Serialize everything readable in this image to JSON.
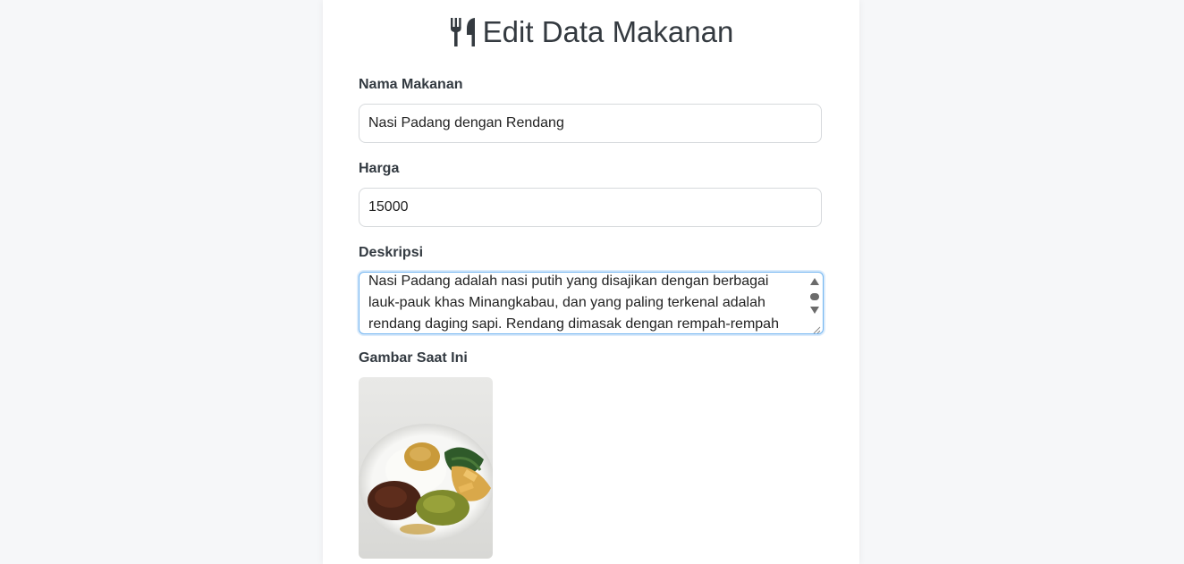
{
  "page": {
    "title": "Edit Data Makanan",
    "title_icon": "utensils-icon"
  },
  "form": {
    "nama_label": "Nama Makanan",
    "nama_value": "Nasi Padang dengan Rendang",
    "harga_label": "Harga",
    "harga_value": "15000",
    "deskripsi_label": "Deskripsi",
    "deskripsi_lines": [
      "Nasi Padang adalah nasi putih yang disajikan dengan berbagai",
      "lauk-pauk khas Minangkabau, dan yang paling terkenal adalah",
      "rendang daging sapi. Rendang dimasak dengan rempah-rempah"
    ],
    "gambar_label": "Gambar Saat Ini",
    "gambar_image": "food-photo-nasi-padang"
  },
  "colors": {
    "background": "#f6f7f9",
    "card": "#ffffff",
    "focus_border": "#6fb3f0"
  }
}
